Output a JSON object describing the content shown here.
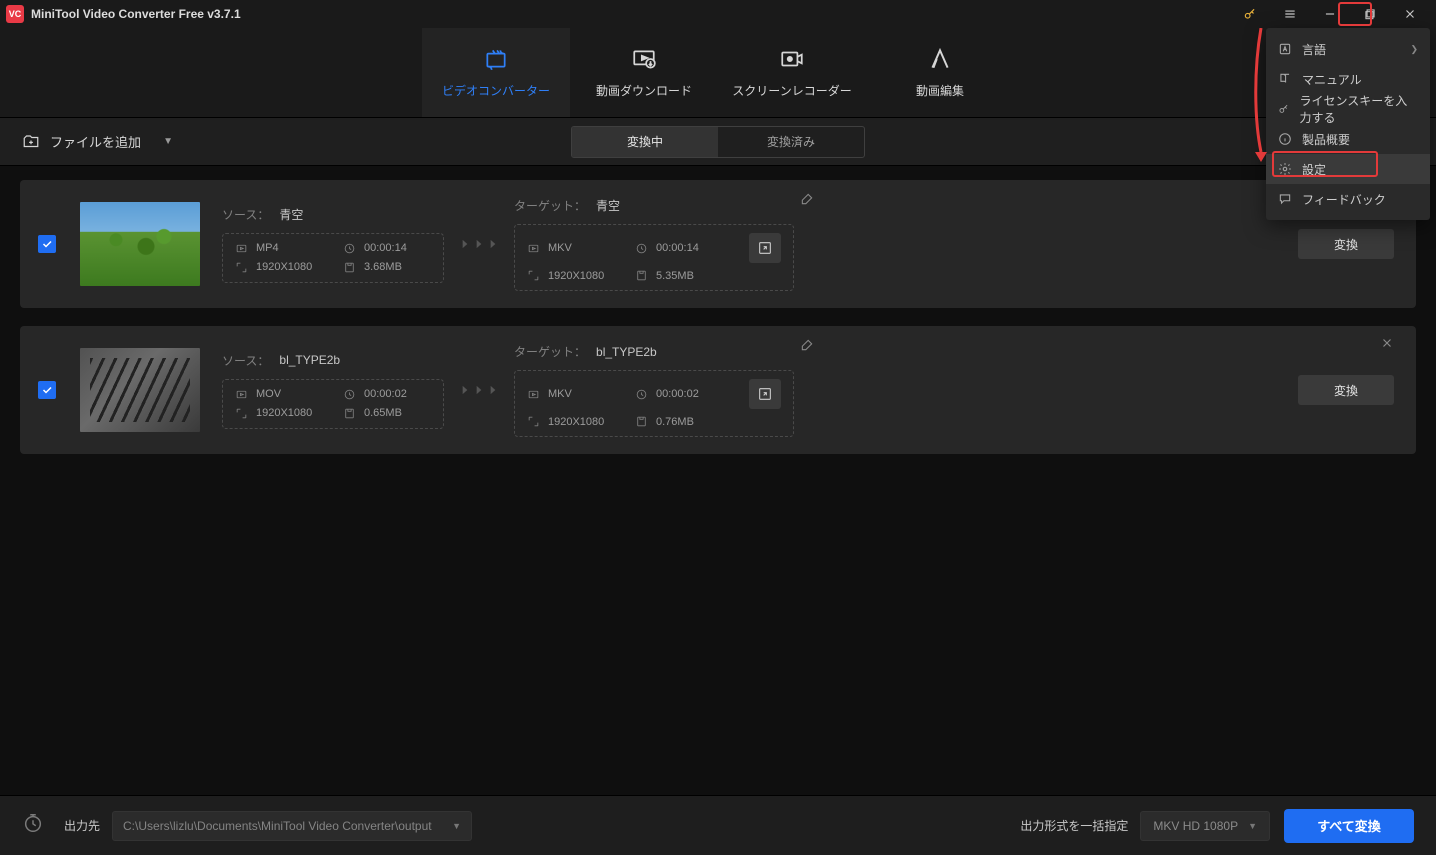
{
  "title": "MiniTool Video Converter Free v3.7.1",
  "tabs": [
    {
      "label": "ビデオコンバーター"
    },
    {
      "label": "動画ダウンロード"
    },
    {
      "label": "スクリーンレコーダー"
    },
    {
      "label": "動画編集"
    }
  ],
  "subbar": {
    "add_file": "ファイルを追加",
    "seg_converting": "変換中",
    "seg_converted": "変換済み"
  },
  "labels": {
    "source": "ソース：",
    "target": "ターゲット："
  },
  "items": [
    {
      "name": "青空",
      "source": {
        "format": "MP4",
        "duration": "00:00:14",
        "resolution": "1920X1080",
        "size": "3.68MB"
      },
      "target_name": "青空",
      "target": {
        "format": "MKV",
        "duration": "00:00:14",
        "resolution": "1920X1080",
        "size": "5.35MB"
      },
      "convert": "変換"
    },
    {
      "name": "bl_TYPE2b",
      "source": {
        "format": "MOV",
        "duration": "00:00:02",
        "resolution": "1920X1080",
        "size": "0.65MB"
      },
      "target_name": "bl_TYPE2b",
      "target": {
        "format": "MKV",
        "duration": "00:00:02",
        "resolution": "1920X1080",
        "size": "0.76MB"
      },
      "convert": "変換"
    }
  ],
  "bottom": {
    "output_label": "出力先",
    "output_path": "C:\\Users\\lizlu\\Documents\\MiniTool Video Converter\\output",
    "format_label": "出力形式を一括指定",
    "format_value": "MKV HD 1080P",
    "convert_all": "すべて変換"
  },
  "menu": {
    "language": "言語",
    "manual": "マニュアル",
    "license": "ライセンスキーを入力する",
    "about": "製品概要",
    "settings": "設定",
    "feedback": "フィードバック"
  }
}
